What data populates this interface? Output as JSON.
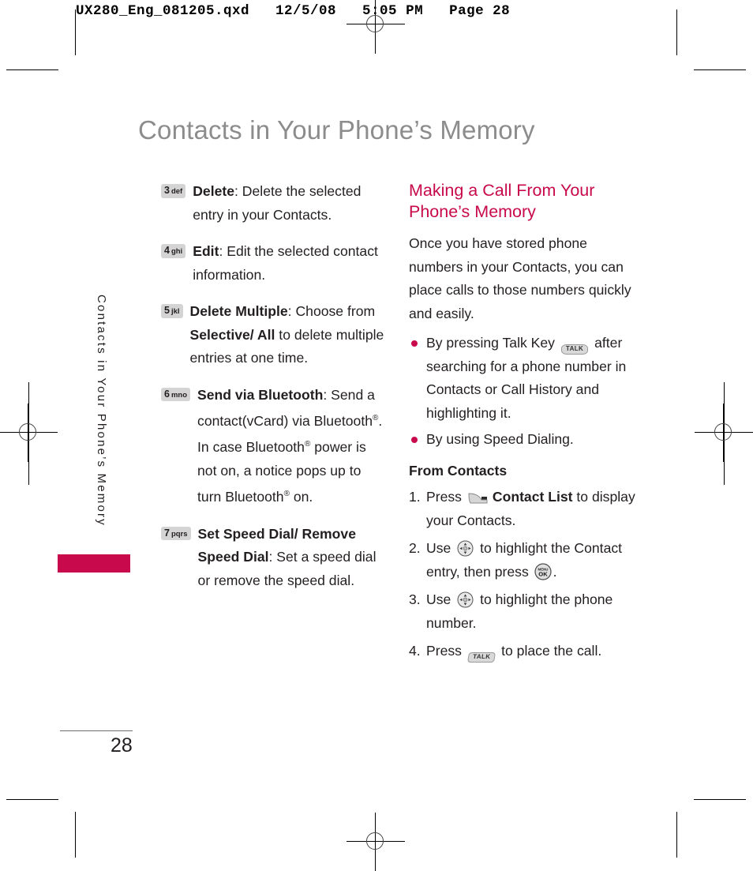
{
  "prepress": {
    "header": "UX280_Eng_081205.qxd   12/5/08   5:05 PM   Page 28"
  },
  "page": {
    "title": "Contacts in Your Phone’s Memory",
    "side_tab_label": "Contacts in Your Phone’s Memory",
    "number": "28",
    "accent_color": "#c8094b",
    "title_color": "#8c8c8c"
  },
  "left_column": {
    "items": [
      {
        "key_num": "3",
        "key_letters": "def",
        "term": "Delete",
        "text": ": Delete the selected entry in your Contacts."
      },
      {
        "key_num": "4",
        "key_letters": "ghi",
        "term": "Edit",
        "text": ": Edit the selected contact information."
      },
      {
        "key_num": "5",
        "key_letters": "jkl",
        "term": "Delete Multiple",
        "text": ": Choose from ",
        "term2": "Selective/ All",
        "text2": " to delete multiple entries at one time."
      },
      {
        "key_num": "6",
        "key_letters": "mno",
        "term": "Send via Bluetooth",
        "text": ": Send a contact(vCard) via Bluetooth®. In case Bluetooth® power is not on, a notice pops up to turn Bluetooth® on."
      },
      {
        "key_num": "7",
        "key_letters": "pqrs",
        "term": "Set Speed Dial/ Remove Speed Dial",
        "text": ": Set a speed dial or remove the speed dial."
      }
    ]
  },
  "right_column": {
    "heading": "Making a Call From Your Phone’s Memory",
    "intro": "Once you have stored phone numbers in your Contacts, you can place calls to those numbers quickly and easily.",
    "bullets": [
      {
        "before": "By pressing Talk Key ",
        "key_label": "TALK",
        "after": " after searching for a phone number in Contacts or Call History and highlighting it."
      },
      {
        "before": "By using Speed Dialing.",
        "key_label": "",
        "after": ""
      }
    ],
    "subhead": "From Contacts",
    "steps": [
      {
        "num": "1.",
        "before": "Press ",
        "icon": "soft-key",
        "bold": "Contact List",
        "after": " to display your Contacts."
      },
      {
        "num": "2.",
        "before": "Use ",
        "icon": "nav-key",
        "mid": " to highlight the Contact entry, then press ",
        "icon2": "ok-key",
        "after": "."
      },
      {
        "num": "3.",
        "before": "Use ",
        "icon": "nav-key",
        "after": " to highlight the phone number."
      },
      {
        "num": "4.",
        "before": "Press ",
        "icon": "talk-key",
        "key_label": "TALK",
        "after": " to place the call."
      }
    ]
  }
}
